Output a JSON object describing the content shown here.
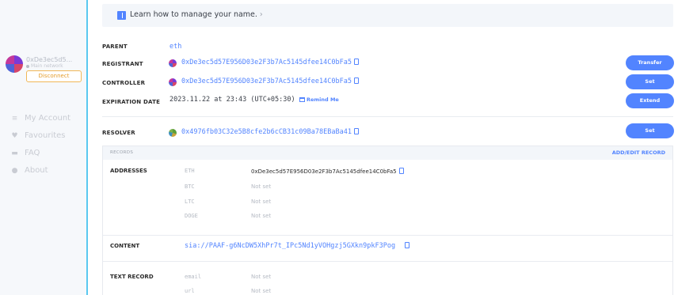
{
  "sidebar": {
    "account_address": "0xDe3ec5d5...",
    "network": "Main network",
    "disconnect_label": "Disconnect",
    "nav": [
      {
        "label": "My Account",
        "icon": "list-icon"
      },
      {
        "label": "Favourites",
        "icon": "heart-icon"
      },
      {
        "label": "FAQ",
        "icon": "chat-icon"
      },
      {
        "label": "About",
        "icon": "info-icon"
      }
    ]
  },
  "banner": {
    "text": "Learn how to manage your name.",
    "icon": "book-icon"
  },
  "details": {
    "parent": {
      "label": "PARENT",
      "value": "eth"
    },
    "registrant": {
      "label": "REGISTRANT",
      "value": "0xDe3ec5d57E956D03e2F3b7Ac5145dfee14C0bFa5",
      "button": "Transfer"
    },
    "controller": {
      "label": "CONTROLLER",
      "value": "0xDe3ec5d57E956D03e2F3b7Ac5145dfee14C0bFa5",
      "button": "Set"
    },
    "expiration": {
      "label": "EXPIRATION DATE",
      "value": "2023.11.22 at 23:43 (UTC+05:30)",
      "remind": "Remind Me",
      "button": "Extend"
    },
    "resolver": {
      "label": "RESOLVER",
      "value": "0x4976fb03C32e5B8cfe2b6cCB31c09Ba78EBaBa41",
      "button": "Set"
    }
  },
  "records": {
    "title": "RECORDS",
    "add_edit": "ADD/EDIT RECORD",
    "addresses_label": "ADDRESSES",
    "addresses": [
      {
        "coin": "ETH",
        "value": "0xDe3ec5d57E956D03e2F3b7Ac5145dfee14C0bFa5"
      },
      {
        "coin": "BTC",
        "value": "Not set"
      },
      {
        "coin": "LTC",
        "value": "Not set"
      },
      {
        "coin": "DOGE",
        "value": "Not set"
      }
    ],
    "content_label": "CONTENT",
    "content_value": "sia://PAAF-g6NcDW5XhPr7t_IPc5Nd1yVOHgzj5GXkn9pkF3Pog",
    "text_record_label": "TEXT RECORD",
    "text_records": [
      {
        "key": "email",
        "value": "Not set"
      },
      {
        "key": "url",
        "value": "Not set"
      }
    ]
  },
  "colors": {
    "accent": "#5284ff",
    "sidebar_edge": "#5ac8f0",
    "disconnect": "#e49c2a"
  }
}
